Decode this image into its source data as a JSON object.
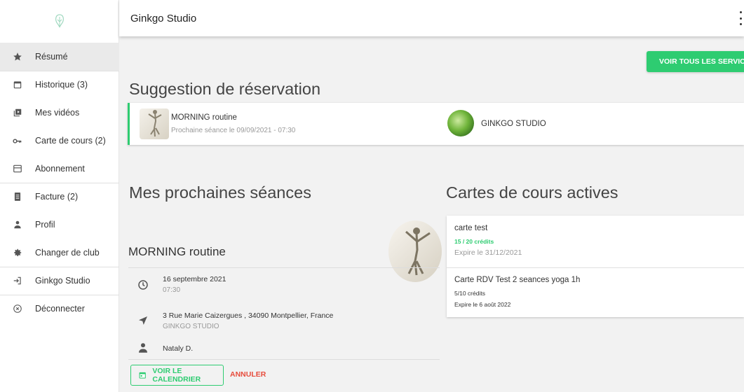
{
  "app": {
    "title": "Ginkgo Studio"
  },
  "sidebar": {
    "items": [
      {
        "label": "Résumé",
        "icon": "star-icon"
      },
      {
        "label": "Historique (3)",
        "icon": "calendar-icon"
      },
      {
        "label": "Mes vidéos",
        "icon": "video-library-icon"
      },
      {
        "label": "Carte de cours (2)",
        "icon": "key-icon"
      },
      {
        "label": "Abonnement",
        "icon": "credit-card-icon"
      },
      {
        "label": "Facture (2)",
        "icon": "invoice-icon"
      },
      {
        "label": "Profil",
        "icon": "person-icon"
      },
      {
        "label": "Changer de club",
        "icon": "gear-icon"
      },
      {
        "label": "Ginkgo Studio",
        "icon": "login-icon"
      },
      {
        "label": "Déconnecter",
        "icon": "close-circle-icon"
      }
    ]
  },
  "toolbar": {
    "services_label": "VOIR TOUS LES SERVICES"
  },
  "suggestion": {
    "heading": "Suggestion de réservation",
    "title": "MORNING routine",
    "next_session": "Prochaine séance le 09/09/2021 - 07:30",
    "club": "GINKGO STUDIO"
  },
  "sessions": {
    "heading": "Mes prochaines séances",
    "title": "MORNING routine",
    "date": "16 septembre 2021",
    "time": "07:30",
    "address": "3 Rue Marie Caizergues , 34090 Montpellier, France",
    "venue": "GINKGO STUDIO",
    "coach": "Nataly D.",
    "calendar_label": "VOIR LE CALENDRIER",
    "cancel_label": "ANNULER"
  },
  "cards": {
    "heading": "Cartes de cours actives",
    "items": [
      {
        "name": "carte test",
        "credits": "15 / 20 crédits",
        "expiry": "Expire le 31/12/2021"
      },
      {
        "name": "Carte RDV Test 2 seances yoga 1h",
        "credits": "5/10 crédits",
        "expiry": "Expire le 6 août 2022"
      }
    ]
  },
  "colors": {
    "accent": "#2ecc71",
    "danger": "#e74c3c"
  }
}
